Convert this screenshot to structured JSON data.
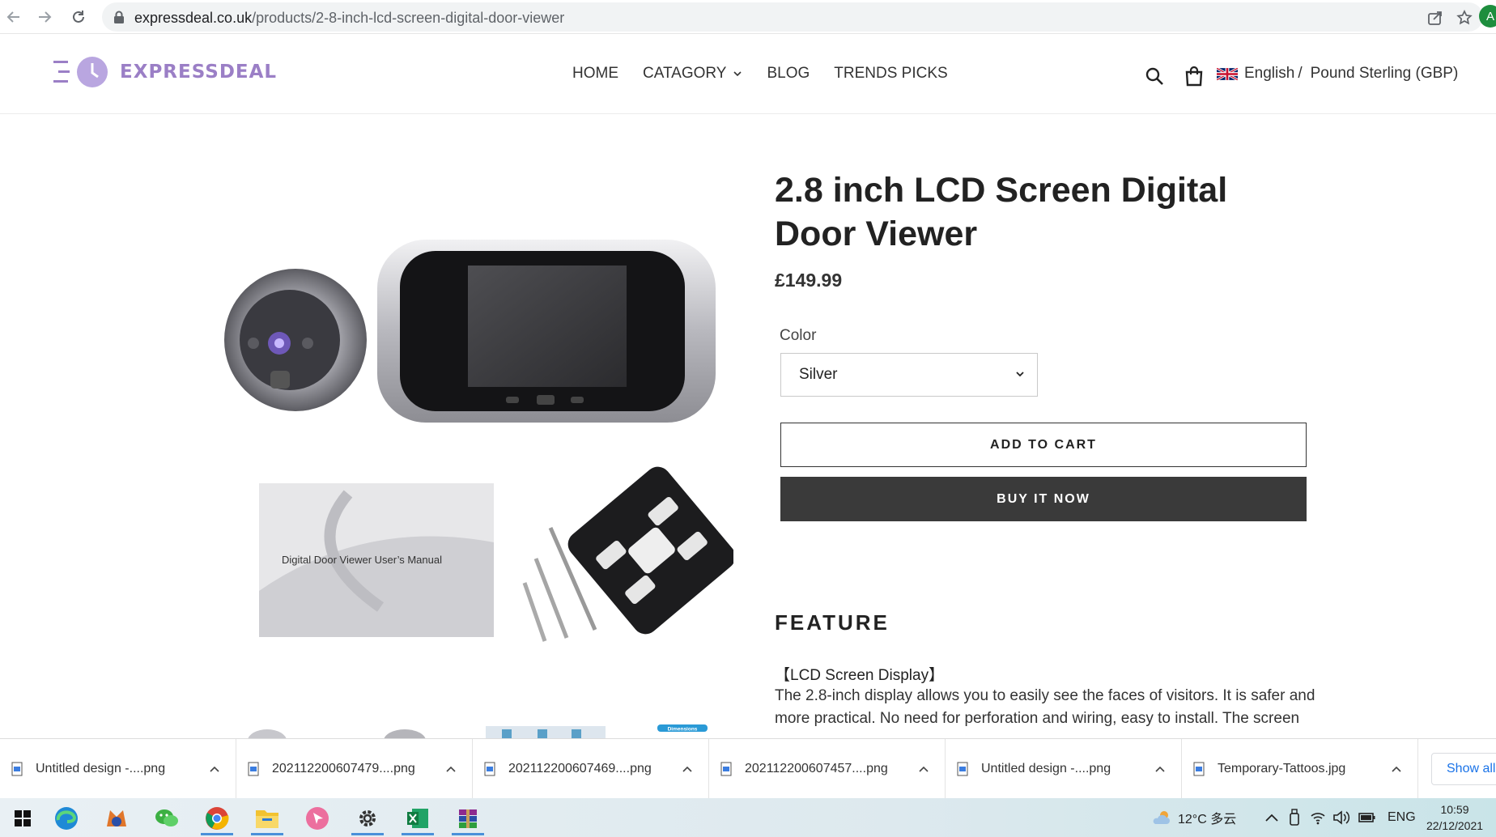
{
  "browser": {
    "url_domain": "expressdeal.co.uk",
    "url_path": "/products/2-8-inch-lcd-screen-digital-door-viewer",
    "profile_initial": "A"
  },
  "store": {
    "logo_text": "EXPRESSDEAL",
    "nav": [
      {
        "label": "HOME"
      },
      {
        "label": "CATAGORY"
      },
      {
        "label": "BLOG"
      },
      {
        "label": "TRENDS PICKS"
      }
    ],
    "language": "English",
    "language_sep": "/",
    "currency": "Pound Sterling (GBP)"
  },
  "product": {
    "title": "2.8 inch LCD Screen Digital Door Viewer",
    "price": "£149.99",
    "color_label": "Color",
    "color_selected": "Silver",
    "add_to_cart": "ADD TO CART",
    "buy_now": "BUY IT NOW",
    "feature_heading": "FEATURE",
    "feature_subheading": "【LCD Screen Display】",
    "feature_text": "The 2.8-inch display allows you to easily see the faces of visitors. It is safer and more practical. No need for perforation and wiring, easy to install. The screen",
    "manual_caption": "Digital Door Viewer User’s Manual",
    "thumb_label": "Dimensions"
  },
  "downloads": {
    "items": [
      {
        "name": "Untitled design -....png"
      },
      {
        "name": "202112200607479....png"
      },
      {
        "name": "202112200607469....png"
      },
      {
        "name": "202112200607457....png"
      },
      {
        "name": "Untitled design -....png"
      },
      {
        "name": "Temporary-Tattoos.jpg"
      }
    ],
    "show_all": "Show all"
  },
  "taskbar": {
    "weather": "12°C 多云",
    "input_lang": "ENG",
    "time": "10:59",
    "date": "22/12/2021"
  },
  "colors": {
    "logo_purple": "#9b7fc6",
    "buy_button": "#3a3a3a",
    "link_blue": "#1a73e8"
  }
}
